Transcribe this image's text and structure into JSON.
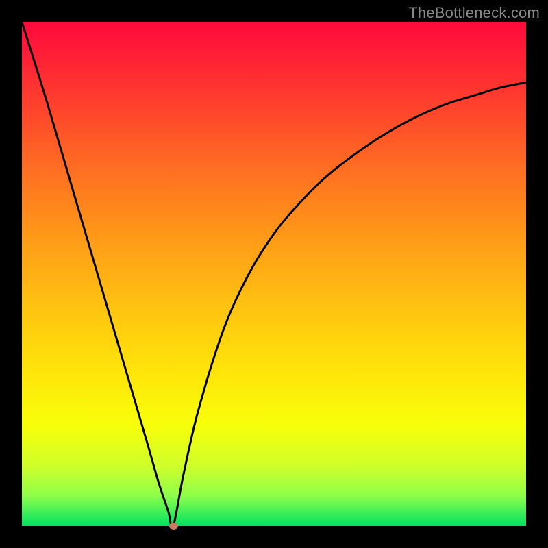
{
  "watermark": "TheBottleneck.com",
  "chart_data": {
    "type": "line",
    "title": "",
    "xlabel": "",
    "ylabel": "",
    "xlim": [
      0,
      100
    ],
    "ylim": [
      0,
      100
    ],
    "grid": false,
    "legend": false,
    "annotations": [],
    "series": [
      {
        "name": "curve",
        "x": [
          0,
          5,
          10,
          15,
          20,
          25,
          27,
          29,
          30,
          32,
          35,
          40,
          45,
          50,
          55,
          60,
          65,
          70,
          75,
          80,
          85,
          90,
          95,
          100
        ],
        "values": [
          100,
          84,
          67,
          50,
          33,
          16,
          9,
          3,
          0,
          10,
          23,
          39,
          50,
          58,
          64,
          69,
          73,
          76.5,
          79.5,
          82,
          84,
          85.5,
          87,
          88
        ]
      }
    ],
    "marker": {
      "x": 30,
      "y": 0,
      "color": "#c97a60"
    },
    "colors": {
      "curve": "#000000",
      "background_top": "#ff0a3c",
      "background_bottom": "#00e060",
      "frame": "#000000",
      "watermark": "#8a8a8a"
    }
  }
}
